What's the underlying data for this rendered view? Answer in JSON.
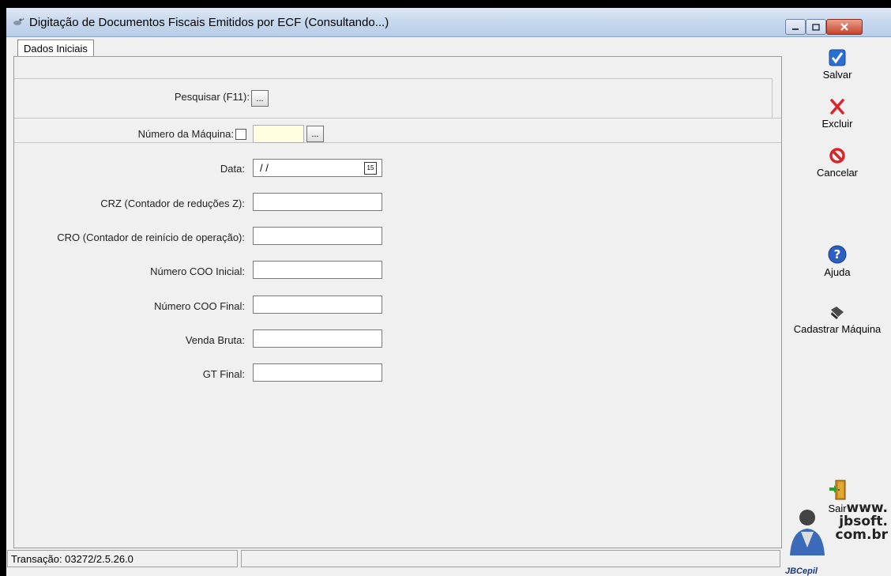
{
  "window": {
    "title": "Digitação de Documentos Fiscais Emitidos por ECF (Consultando...)",
    "icon": "satellite-app-icon",
    "controls": [
      "minimize-icon",
      "maximize-icon",
      "close-icon"
    ]
  },
  "tabs": [
    {
      "label": "Dados Iniciais",
      "selected": true
    }
  ],
  "form": {
    "pesquisar_label": "Pesquisar (F11):",
    "ellipsis": "...",
    "numero_maquina_label": "Número da Máquina:",
    "numero_maquina_value": "",
    "data_label": "Data:",
    "data_value": "/ /",
    "calendar_glyph": "15",
    "crz_label": "CRZ (Contador de reduções Z):",
    "crz_value": "",
    "cro_label": "CRO (Contador de reinício de operação):",
    "cro_value": "",
    "coo_inicial_label": "Número COO Inicial:",
    "coo_inicial_value": "",
    "coo_final_label": "Número COO Final:",
    "coo_final_value": "",
    "venda_bruta_label": "Venda Bruta:",
    "venda_bruta_value": "",
    "gt_final_label": "GT Final:",
    "gt_final_value": ""
  },
  "toolbar": {
    "salvar": {
      "label": "Salvar",
      "icon": "check-icon"
    },
    "excluir": {
      "label": "Excluir",
      "icon": "delete-x-icon"
    },
    "cancelar": {
      "label": "Cancelar",
      "icon": "cancel-icon"
    },
    "ajuda": {
      "label": "Ajuda",
      "icon": "help-icon"
    },
    "cadastrar": {
      "label": "Cadastrar Máquina",
      "icon": "stamp-icon"
    },
    "sair": {
      "label": "Sair",
      "icon": "exit-door-icon"
    }
  },
  "status": {
    "transacao": "Transação: 03272/2.5.26.0"
  },
  "logo": {
    "line1": "www.",
    "line2": "jbsoft.",
    "line3": "com.br",
    "brand": "JBCepil"
  },
  "colors": {
    "titlebar": "#c8d9ee",
    "close_button": "#c9442b",
    "check_blue": "#2a6fd1",
    "delete_red": "#d8262b",
    "yellow_field": "#fffde0"
  }
}
